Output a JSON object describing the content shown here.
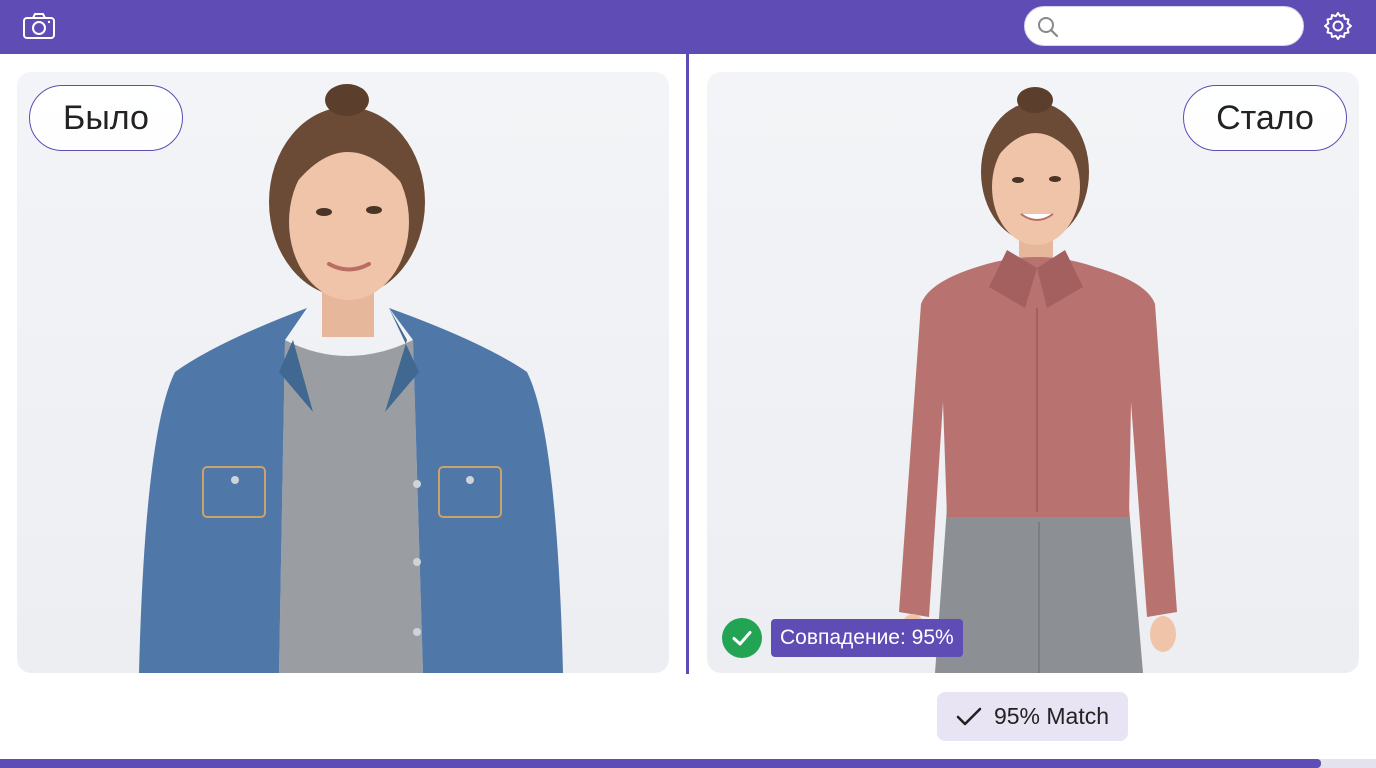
{
  "header": {
    "camera_icon": "camera-icon",
    "search": {
      "placeholder": "",
      "value": "",
      "icon": "search-icon"
    },
    "settings_icon": "gear-icon",
    "accent_color": "#5f4cb5"
  },
  "comparison": {
    "before_label": "Было",
    "after_label": "Стало",
    "before_outfit": "denim jacket, grey t-shirt",
    "after_outfit": "rose blouse, grey trousers"
  },
  "match": {
    "badge_text": "Совпадение: 95%",
    "badge_icon": "check-circle-icon",
    "badge_color": "#23a455",
    "button_label": "95% Match",
    "button_icon": "check-icon",
    "percent": 95
  },
  "progress": {
    "fraction": 0.96
  }
}
